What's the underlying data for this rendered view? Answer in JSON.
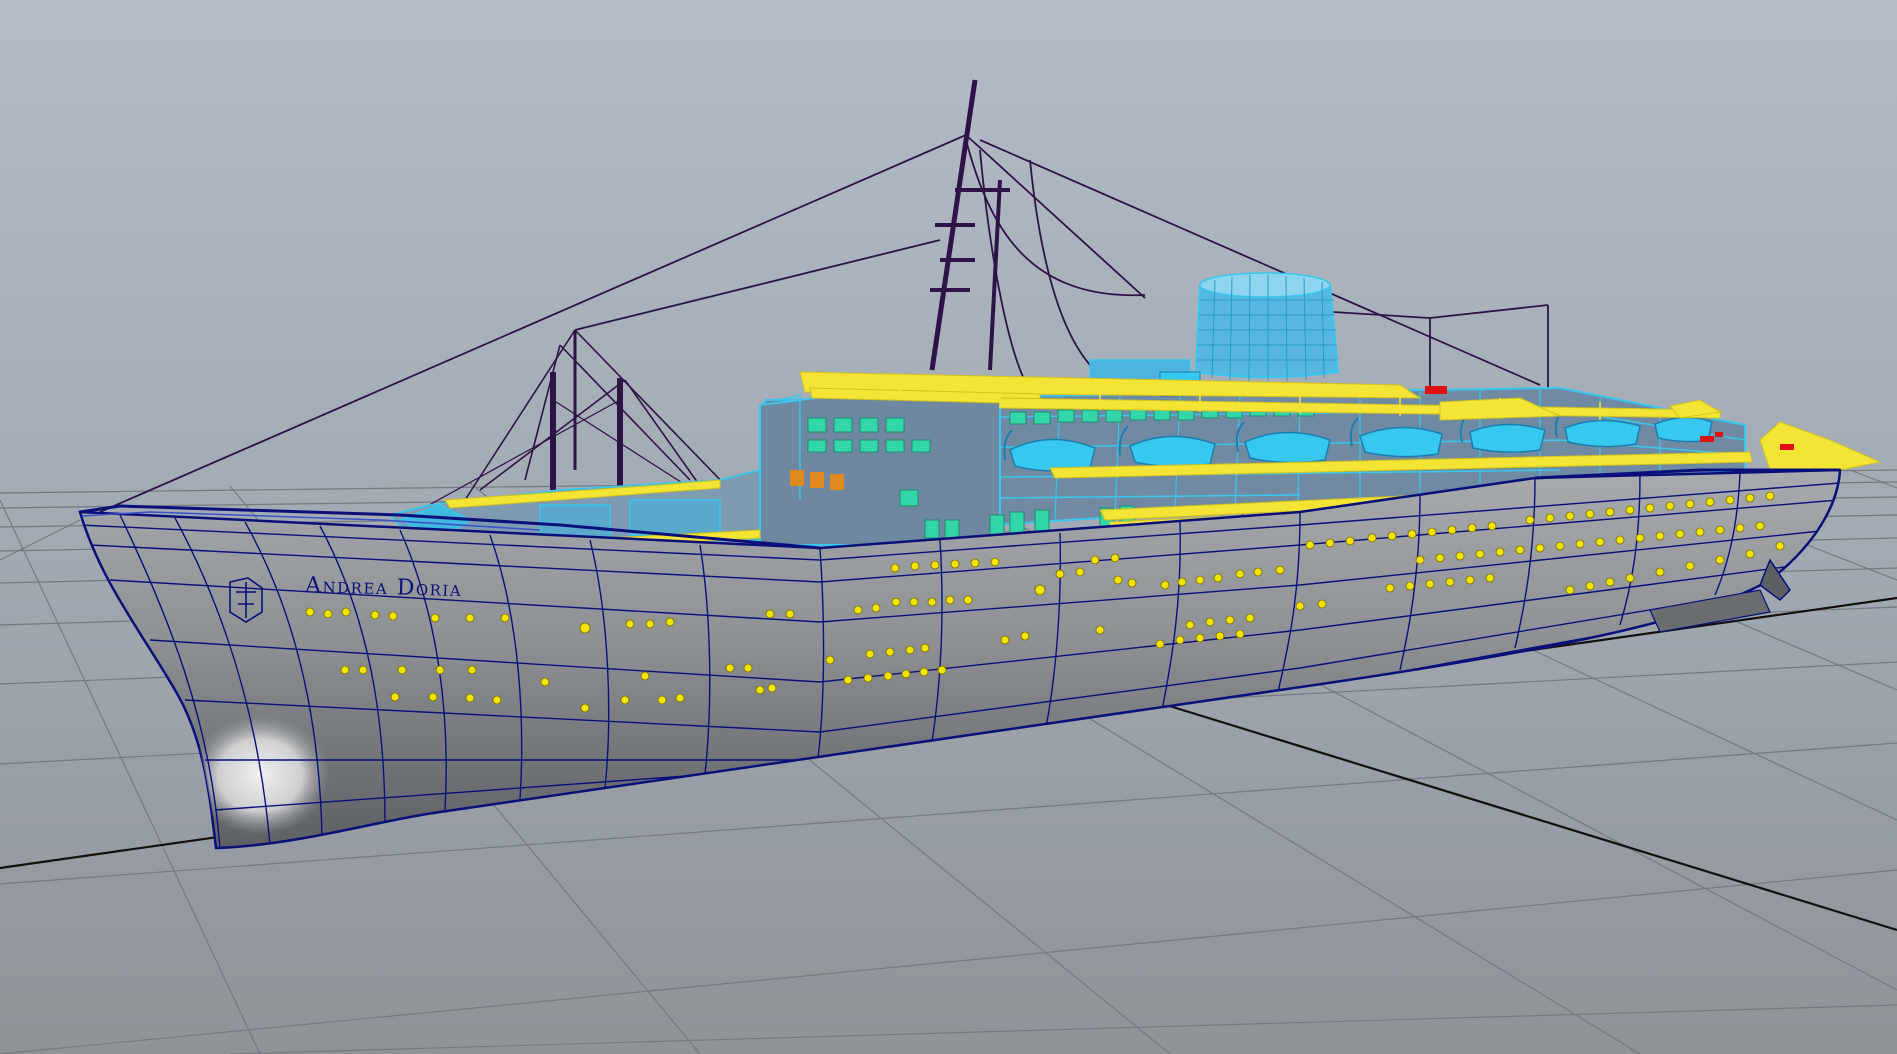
{
  "viewport": {
    "hull_name": "Andrea Doria"
  },
  "colors": {
    "background_top": "#b3bcc7",
    "background_bottom": "#8f9398",
    "grid_line": "#757a80",
    "grid_axis": "#111111",
    "wireframe": "#0b0f7a",
    "rigging": "#2e1446",
    "portholes": "#f2e400",
    "selected_deck": "#f4e436",
    "selected_superstructure": "#36c8ee",
    "selected_windows": "#32d6a8",
    "accent_red": "#e01010"
  },
  "icons": {
    "ship_emblem": "ship-crest-icon"
  }
}
